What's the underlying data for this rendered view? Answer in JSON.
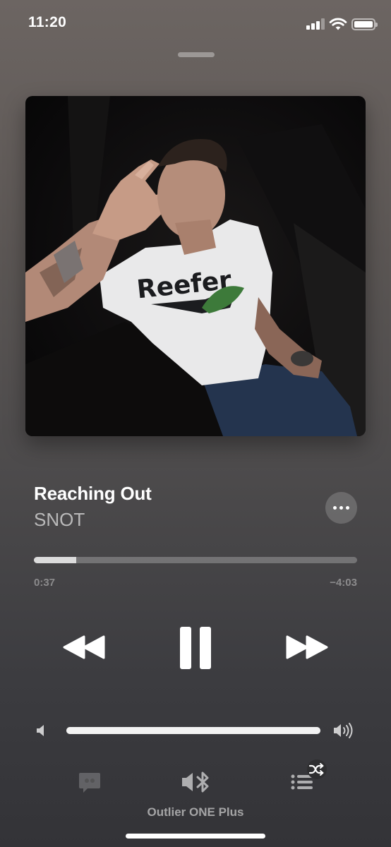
{
  "status_bar": {
    "time": "11:20",
    "icons": [
      "cellular-signal-icon",
      "wifi-icon",
      "battery-icon"
    ]
  },
  "artwork": {
    "shirt_text": "Reefer"
  },
  "now_playing": {
    "title": "Reaching Out",
    "artist": "SNOT",
    "elapsed": "0:37",
    "remaining": "−4:03",
    "progress_fraction": 0.13
  },
  "controls": {
    "icons": [
      "rewind-icon",
      "pause-icon",
      "fast-forward-icon"
    ]
  },
  "volume": {
    "level_fraction": 1.0,
    "icons": [
      "volume-low-icon",
      "volume-high-icon"
    ]
  },
  "bottom_bar": {
    "device_name": "Outlier ONE Plus",
    "icons": [
      "lyrics-icon",
      "speaker-bluetooth-icon",
      "queue-shuffle-icon"
    ]
  },
  "colors": {
    "accent": "#ffffff",
    "background_top": "#6c6562",
    "background_bottom": "#333337"
  }
}
